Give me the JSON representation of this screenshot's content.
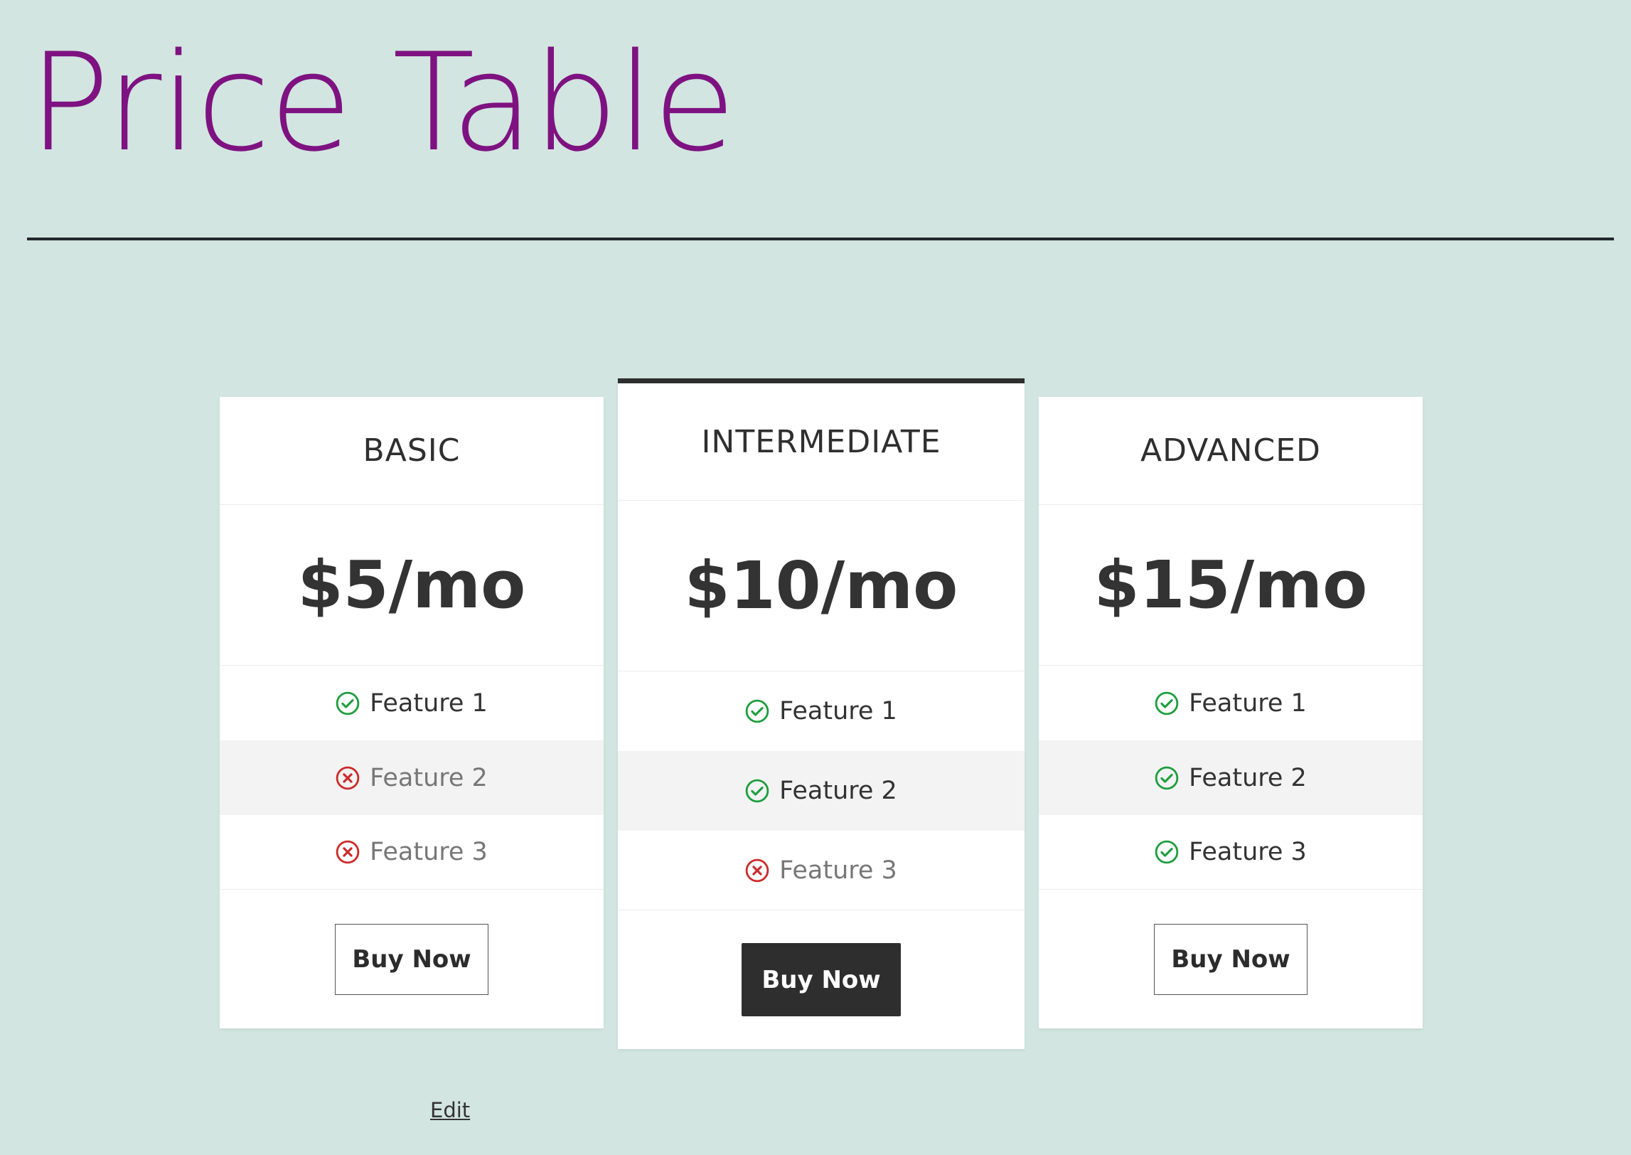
{
  "page": {
    "title": "Price Table",
    "title_color": "#7e1281",
    "background_color": "#d2e5e0"
  },
  "plans": [
    {
      "name": "BASIC",
      "price": "$5/mo",
      "features": [
        {
          "label": "Feature 1",
          "included": true,
          "icon": "check-circle-icon"
        },
        {
          "label": "Feature 2",
          "included": false,
          "icon": "x-circle-icon"
        },
        {
          "label": "Feature 3",
          "included": false,
          "icon": "x-circle-icon"
        }
      ],
      "button_label": "Buy Now",
      "button_style": "outline"
    },
    {
      "name": "INTERMEDIATE",
      "price": "$10/mo",
      "highlighted": true,
      "features": [
        {
          "label": "Feature 1",
          "included": true,
          "icon": "check-circle-icon"
        },
        {
          "label": "Feature 2",
          "included": true,
          "icon": "check-circle-icon"
        },
        {
          "label": "Feature 3",
          "included": false,
          "icon": "x-circle-icon"
        }
      ],
      "button_label": "Buy Now",
      "button_style": "filled"
    },
    {
      "name": "ADVANCED",
      "price": "$15/mo",
      "features": [
        {
          "label": "Feature 1",
          "included": true,
          "icon": "check-circle-icon"
        },
        {
          "label": "Feature 2",
          "included": true,
          "icon": "check-circle-icon"
        },
        {
          "label": "Feature 3",
          "included": true,
          "icon": "check-circle-icon"
        }
      ],
      "button_label": "Buy Now",
      "button_style": "outline"
    }
  ],
  "edit_link": "Edit",
  "colors": {
    "included": "#1e9e3e",
    "excluded": "#cc2b2b",
    "button_dark": "#2e2e2e"
  }
}
